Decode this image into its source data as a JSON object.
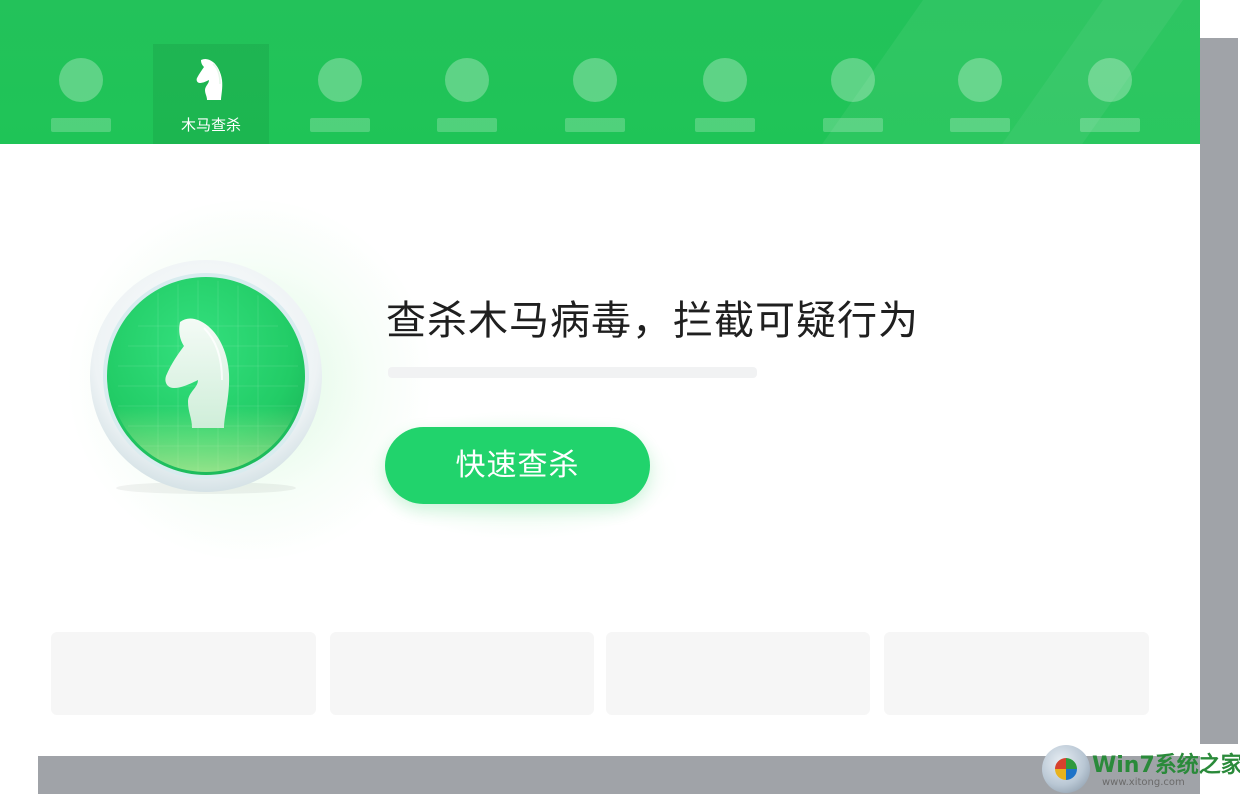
{
  "nav": {
    "active_label": "木马查杀"
  },
  "hero": {
    "headline": "查杀木马病毒，拦截可疑行为",
    "scan_button": "快速查杀"
  },
  "colors": {
    "brand_green": "#21d36c",
    "topbar_green": "#22c35a",
    "shadow_gray": "#a0a3a8"
  },
  "icons": {
    "active_nav": "horse-icon",
    "hero_badge": "horse-shield-icon"
  },
  "watermark": {
    "text": "Win7系统之家",
    "sub": "www.xitong.com"
  }
}
